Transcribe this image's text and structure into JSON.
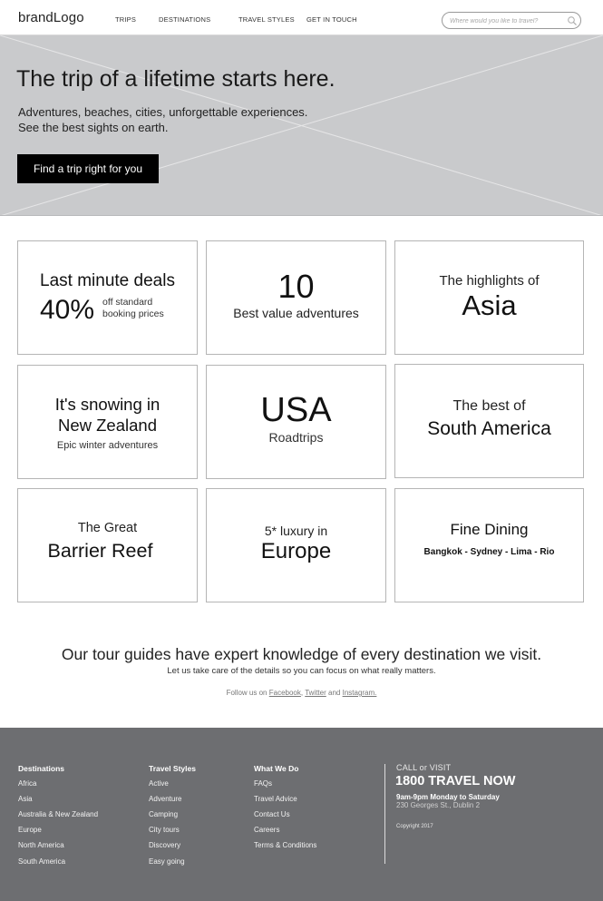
{
  "header": {
    "logo": "brandLogo",
    "nav": [
      "TRIPS",
      "DESTINATIONS",
      "TRAVEL STYLES",
      "GET IN TOUCH"
    ],
    "search_placeholder": "Where would you like to travel?"
  },
  "hero": {
    "title": "The trip of a lifetime starts here.",
    "subtitle_line1": "Adventures, beaches, cities, unforgettable experiences.",
    "subtitle_line2": "See the best sights on earth.",
    "cta": "Find a trip right for you"
  },
  "cards": {
    "deals": {
      "title": "Last minute deals",
      "percent": "40%",
      "note_line1": "off standard",
      "note_line2": "booking prices"
    },
    "ten": {
      "number": "10",
      "label": "Best value adventures"
    },
    "asia": {
      "pre": "The highlights of",
      "main": "Asia"
    },
    "nz": {
      "line1": "It's snowing in",
      "line2": "New Zealand",
      "sub": "Epic winter adventures"
    },
    "usa": {
      "main": "USA",
      "sub": "Roadtrips"
    },
    "sa": {
      "pre": "The best of",
      "main": "South America"
    },
    "reef": {
      "pre": "The Great",
      "main": "Barrier Reef"
    },
    "europe": {
      "pre": "5* luxury in",
      "main": "Europe"
    },
    "dining": {
      "pre": "Fine Dining",
      "cities": "Bangkok - Sydney - Lima - Rio"
    }
  },
  "tagline": {
    "main": "Our tour guides have expert knowledge of every destination we visit.",
    "sub": "Let us take care of the details so you can focus on what really matters.",
    "follow_prefix": "Follow us on",
    "facebook": "Facebook",
    "twitter": "Twitter",
    "and": "and",
    "instagram": "Instagram."
  },
  "footer": {
    "destinations": {
      "heading": "Destinations",
      "items": [
        "Africa",
        "Asia",
        "Australia & New Zealand",
        "Europe",
        "North America",
        "South America"
      ]
    },
    "styles": {
      "heading": "Travel Styles",
      "items": [
        "Active",
        "Adventure",
        "Camping",
        "City tours",
        "Discovery",
        "Easy going"
      ]
    },
    "whatwedo": {
      "heading": "What We Do",
      "items": [
        "FAQs",
        "Travel Advice",
        "Contact Us",
        "Careers",
        "Terms & Conditions"
      ]
    },
    "contact": {
      "call_label": "CALL or VISIT",
      "phone": "1800 TRAVEL NOW",
      "hours": "9am-9pm Monday to Saturday",
      "address": "230 Georges St., Dublin 2",
      "copyright": "Copyright 2017"
    }
  }
}
